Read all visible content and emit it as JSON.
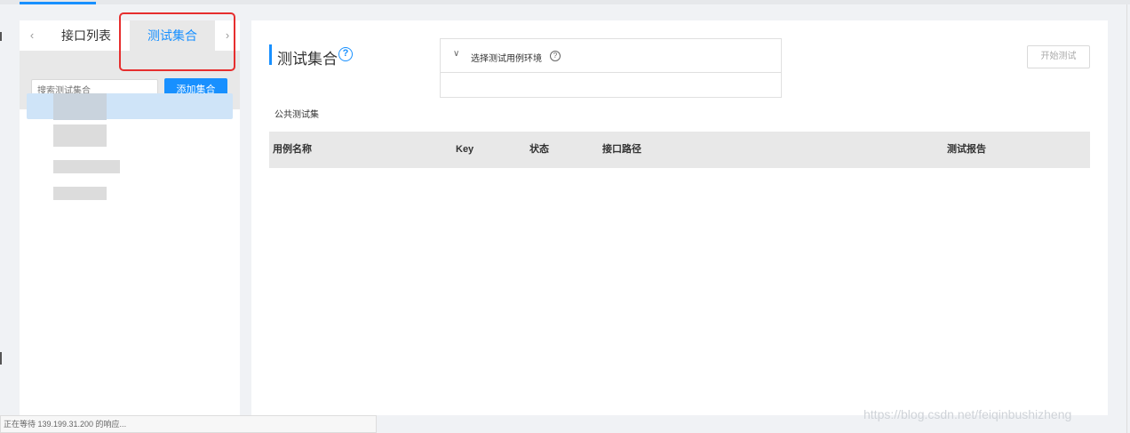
{
  "left_panel": {
    "tabs": [
      {
        "label": "接口列表"
      },
      {
        "label": "测试集合"
      }
    ],
    "search_placeholder": "搜索测试集合",
    "add_button": "添加集合"
  },
  "main": {
    "title": "测试集合",
    "env": {
      "label": "选择测试用例环境"
    },
    "start_button": "开始测试",
    "public_label": "公共测试集",
    "table": {
      "columns": [
        "用例名称",
        "Key",
        "状态",
        "接口路径",
        "测试报告"
      ]
    }
  },
  "status_bar": {
    "text": "正在等待 139.199.31.200 的响应..."
  },
  "watermark": "https://blog.csdn.net/feiqinbushizheng",
  "colors": {
    "accent": "#1890ff",
    "highlight": "#e62e2e",
    "selected_row": "#cfe4f8"
  }
}
